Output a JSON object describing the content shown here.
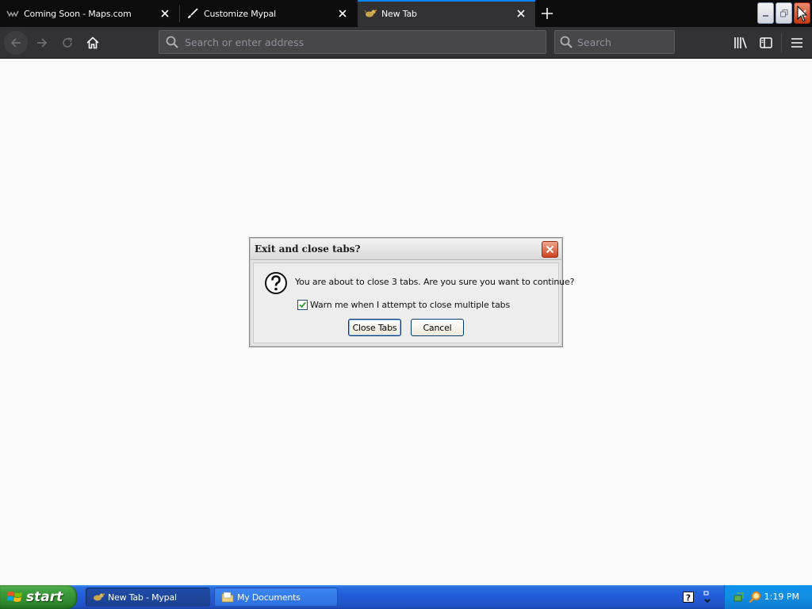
{
  "browser": {
    "tabs": [
      {
        "label": "Coming Soon - Maps.com",
        "icon": "maps-favicon",
        "selected": false
      },
      {
        "label": "Customize Mypal",
        "icon": "brush-icon",
        "selected": false
      },
      {
        "label": "New Tab",
        "icon": "mypal-favicon",
        "selected": true
      }
    ],
    "address_placeholder": "Search or enter address",
    "search_placeholder": "Search",
    "accent": "#0a84ff"
  },
  "dialog": {
    "title": "Exit and close tabs?",
    "message": "You are about to close 3 tabs. Are you sure you want to continue?",
    "checkbox_label": "Warn me when I attempt to close multiple tabs",
    "checkbox_checked": true,
    "primary_button": "Close Tabs",
    "secondary_button": "Cancel",
    "icon": "question-icon"
  },
  "taskbar": {
    "start_label": "start",
    "items": [
      {
        "label": "New Tab - Mypal",
        "icon": "mypal-icon",
        "active": true
      },
      {
        "label": "My Documents",
        "icon": "folder-icon",
        "active": false
      }
    ],
    "clock": "1:19 PM"
  }
}
